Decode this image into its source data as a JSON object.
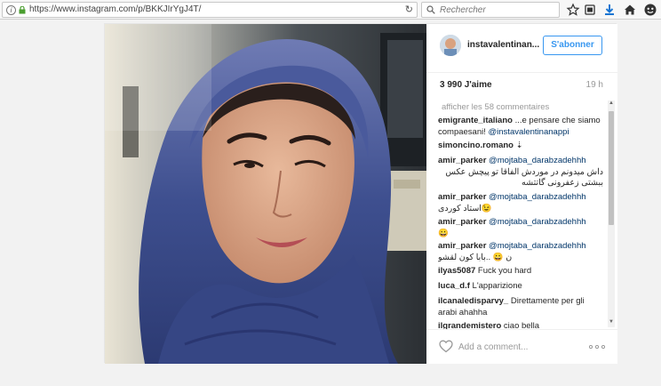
{
  "browser": {
    "url": "https://www.instagram.com/p/BKKJIrYgJ4T/",
    "search_placeholder": "Rechercher"
  },
  "post": {
    "username": "instavalentinan...",
    "follow_label": "S'abonner",
    "likes": "3 990 J'aime",
    "time": "19 h",
    "load_more": "afficher les 58 commentaires",
    "comment_placeholder": "Add a comment...",
    "comments": [
      {
        "user": "emigrante_italiano",
        "text": " ...e pensare che siamo compaesani! ",
        "mention": "@instavalentinanappi"
      },
      {
        "user": "simoncino.romano",
        "text": " ⇣",
        "mention": ""
      },
      {
        "user": "amir_parker",
        "text": " داش میدونم در موردش الفاقا تو پیچش عکس ببشتی زعفرونی گاتتشه",
        "mention": "@mojtaba_darabzadehhh"
      },
      {
        "user": "amir_parker",
        "text": " استاد کوردی😉",
        "mention": "@mojtaba_darabzadehhh"
      },
      {
        "user": "amir_parker",
        "text": " 😀",
        "mention": "@mojtaba_darabzadehhh"
      },
      {
        "user": "amir_parker",
        "text": " ن 😀 ..بابا کون لقشو",
        "mention": "@mojtaba_darabzadehhh"
      },
      {
        "user": "ilyas5087",
        "text": " Fuck you hard",
        "mention": ""
      },
      {
        "user": "luca_d.f",
        "text": " L'apparizione",
        "mention": ""
      },
      {
        "user": "ilcanaledisparvy_",
        "text": " Direttamente per gli arabi ahahha",
        "mention": ""
      },
      {
        "user": "ilgrandemistero",
        "text": " ciao bella",
        "mention": ""
      }
    ]
  },
  "colors": {
    "accent": "#3897f0",
    "scarf": "#3e4f8f",
    "background": "#f2f2f2"
  },
  "icons": [
    "info-icon",
    "lock-icon",
    "reload-icon",
    "search-icon",
    "star-icon",
    "reading-list-icon",
    "download-icon",
    "home-icon",
    "emoji-icon",
    "heart-icon",
    "more-options-icon"
  ]
}
